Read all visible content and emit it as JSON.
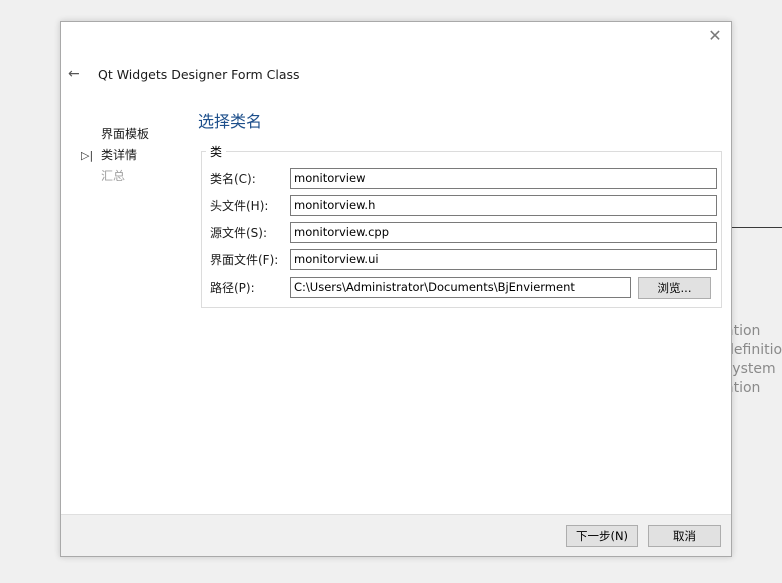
{
  "background": {
    "partial_text_lines": [
      "ation",
      "definition",
      "system",
      "ation"
    ]
  },
  "dialog": {
    "title": "Qt Widgets Designer Form Class",
    "close_icon": "✕",
    "back_icon": "←"
  },
  "steps": [
    {
      "label": "界面模板",
      "state": "done",
      "marker": ""
    },
    {
      "label": "类详情",
      "state": "current",
      "marker": "▷|"
    },
    {
      "label": "汇总",
      "state": "future",
      "marker": ""
    }
  ],
  "page": {
    "title": "选择类名",
    "group_label": "类"
  },
  "fields": {
    "class_name": {
      "label": "类名(C):",
      "value": "monitorview"
    },
    "header_file": {
      "label": "头文件(H):",
      "value": "monitorview.h"
    },
    "source_file": {
      "label": "源文件(S):",
      "value": "monitorview.cpp"
    },
    "form_file": {
      "label": "界面文件(F):",
      "value": "monitorview.ui"
    },
    "path": {
      "label": "路径(P):",
      "value": "C:\\Users\\Administrator\\Documents\\BjEnvierment"
    }
  },
  "buttons": {
    "browse": "浏览...",
    "next": "下一步(N)",
    "cancel": "取消"
  },
  "colors": {
    "page_title": "#1d4f8b",
    "future_step": "#a0a0a0"
  }
}
